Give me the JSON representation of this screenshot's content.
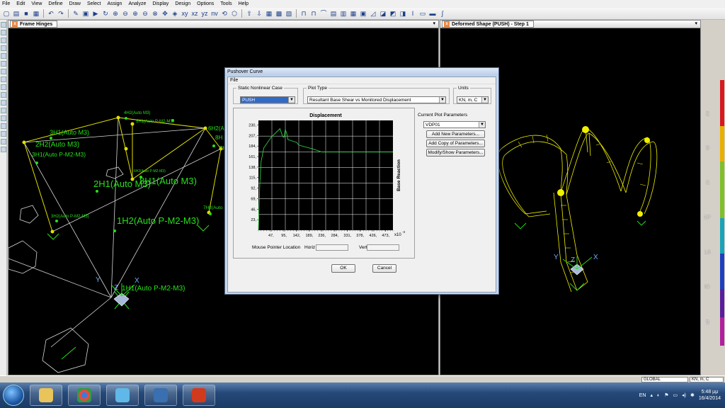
{
  "menu": [
    "File",
    "Edit",
    "View",
    "Define",
    "Draw",
    "Select",
    "Assign",
    "Analyze",
    "Display",
    "Design",
    "Options",
    "Tools",
    "Help"
  ],
  "toolbar_text": [
    "xy",
    "xz",
    "yz",
    "nv"
  ],
  "left_window": {
    "title": "Frame Hinges",
    "hinge_labels": [
      "4H2(Auto M3)",
      "5H1(Auto P-M2-M3)",
      "3H1(Auto M3)",
      "2H2(Auto M3)",
      "3H1(Auto P-M2-M3)",
      "6H2(Au",
      "8H",
      "7H",
      "6H2(Auto P-M2-M3)",
      "2H1(Auto M3)",
      "8H1(Auto M3)",
      "7H2(Auto",
      "3H2(Auto P-M2-M3)",
      "1H2(Auto P-M2-M3)",
      "1H1(Auto P-M2-M3)"
    ],
    "axis_labels": [
      "Y",
      "Z",
      "X"
    ]
  },
  "right_window": {
    "title": "Deformed Shape (PUSH) - Step 1",
    "axis_labels": [
      "Y",
      "Z",
      "X"
    ]
  },
  "legend": {
    "labels": [
      "E",
      "D",
      "C",
      "CP",
      "LS",
      "IO",
      "B"
    ],
    "colors": [
      "#d71920",
      "#e8b000",
      "#7fbf2a",
      "#1aa3b8",
      "#1f3fbf",
      "#5a1e9c",
      "#b0209c"
    ]
  },
  "dialog": {
    "title": "Pushover Curve",
    "menu": "File",
    "case_group": "Static Nonlinear Case",
    "case_value": "PUSH",
    "plot_type_group": "Plot Type",
    "plot_type_value": "Resultant Base Shear vs Monitored Displacement",
    "units_group": "Units",
    "units_value": "KN, m, C",
    "params_label": "Current Plot Parameters",
    "params_value": "VDP01",
    "add_new": "Add New Parameters...",
    "add_copy": "Add Copy of Parameters...",
    "modify": "Modify/Show Parameters...",
    "mouse_label": "Mouse Pointer Location",
    "horiz_label": "Horiz",
    "vert_label": "Vert",
    "ok": "OK",
    "cancel": "Cancel"
  },
  "chart_data": {
    "type": "line",
    "title": "Displacement",
    "xlabel": "",
    "ylabel": "Base Reaction",
    "x_multiplier_label": "x10",
    "x_multiplier_exp": "-3",
    "x_ticks": [
      47,
      95,
      142,
      189,
      236,
      284,
      331,
      378,
      426,
      473
    ],
    "y_ticks": [
      23,
      46,
      69,
      92,
      115,
      138,
      161,
      184,
      207,
      230
    ],
    "xlim": [
      0,
      500
    ],
    "ylim": [
      0,
      240
    ],
    "grid": true,
    "series": [
      {
        "x": [
          0,
          5,
          10,
          20,
          47,
          80,
          90,
          95,
          100,
          105,
          110,
          142,
          150,
          200,
          236,
          473,
          500
        ],
        "y": [
          0,
          100,
          150,
          180,
          203,
          222,
          205,
          203,
          220,
          212,
          198,
          192,
          186,
          178,
          171,
          171,
          171
        ]
      }
    ]
  },
  "status": {
    "coord": "GLOBAL",
    "units": "KN, m, C"
  },
  "tray": {
    "lang": "EN",
    "time": "5:48 μμ",
    "date": "16/4/2014"
  }
}
